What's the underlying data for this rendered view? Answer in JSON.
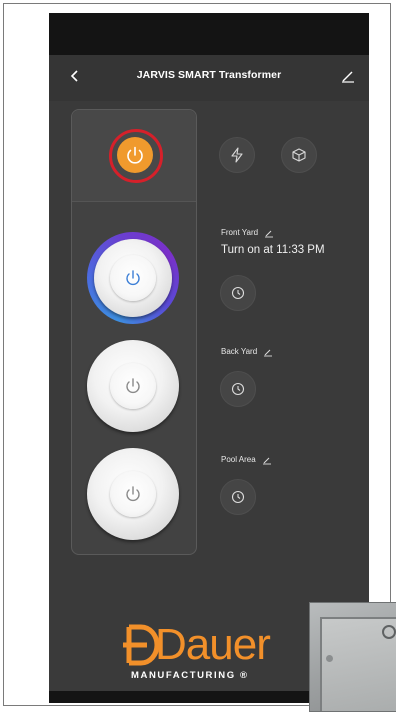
{
  "header": {
    "title": "JARVIS SMART Transformer"
  },
  "outlets": [
    {
      "name": "Front Yard",
      "schedule": "Turn on at 11:33 PM",
      "state": "on"
    },
    {
      "name": "Back Yard",
      "schedule": "",
      "state": "off"
    },
    {
      "name": "Pool Area",
      "schedule": "",
      "state": "off"
    }
  ],
  "brand": {
    "logo_text": "Dauer",
    "tagline": "MANUFACTURING ®"
  },
  "colors": {
    "accent": "#f09a2d",
    "highlight_ring": "#d6202a",
    "background": "#3a3a3a"
  },
  "icons": {
    "back": "chevron-left-icon",
    "edit": "pencil-icon",
    "master_power": "power-icon",
    "energy": "lightning-icon",
    "scene": "cube-icon",
    "timer": "clock-icon"
  }
}
